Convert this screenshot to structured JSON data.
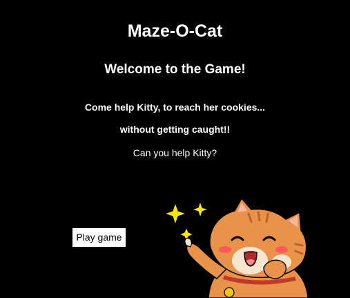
{
  "game": {
    "title": "Maze-O-Cat",
    "subtitle": "Welcome to the Game!",
    "line1": "Come help Kitty, to reach her cookies...",
    "line2": "without getting caught!!",
    "line3": "Can you help Kitty?"
  },
  "controls": {
    "play_label": "Play game"
  },
  "illustration": {
    "icon": "cheering-cat-icon",
    "sparkle_color": "#ffe600",
    "fur_color": "#e8924a"
  },
  "colors": {
    "background": "#000000",
    "text": "#ffffff",
    "button_bg": "#ffffff",
    "button_text": "#000000"
  }
}
